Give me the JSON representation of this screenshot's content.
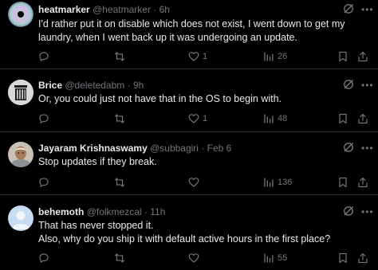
{
  "tweets": [
    {
      "name": "heatmarker",
      "handle": "@heatmarker",
      "sep": "·",
      "time": "6h",
      "lines": [
        "I'd rather put it on disable which does not exist, I went down to get my",
        "laundry, when I went back up it was undergoing an update."
      ],
      "replies": "",
      "retweets": "",
      "likes": "1",
      "views": "26"
    },
    {
      "name": "Brice",
      "handle": "@deletedabm",
      "sep": "·",
      "time": "9h",
      "lines": [
        "Or, you could just not have that in the OS to begin with."
      ],
      "replies": "",
      "retweets": "",
      "likes": "1",
      "views": "48"
    },
    {
      "name": "Jayaram Krishnaswamy",
      "handle": "@subbagiri",
      "sep": "·",
      "time": "Feb 6",
      "lines": [
        "Stop updates if they break."
      ],
      "replies": "",
      "retweets": "",
      "likes": "",
      "views": "136"
    },
    {
      "name": "behemoth",
      "handle": "@folkmezcal",
      "sep": "·",
      "time": "11h",
      "lines": [
        "That has never stopped it.",
        "Also, why do you ship it with default active hours in the first place?"
      ],
      "replies": "",
      "retweets": "",
      "likes": "",
      "views": "55"
    }
  ],
  "icons": {
    "reply": "reply-icon",
    "retweet": "retweet-icon",
    "like": "heart-icon",
    "views": "views-icon",
    "bookmark": "bookmark-icon",
    "share": "share-icon",
    "grok": "grok-icon",
    "more": "more-icon"
  },
  "colors": {
    "background": "#000000",
    "text": "#e7e9ea",
    "muted": "#71767b",
    "divider": "#2f3336"
  }
}
